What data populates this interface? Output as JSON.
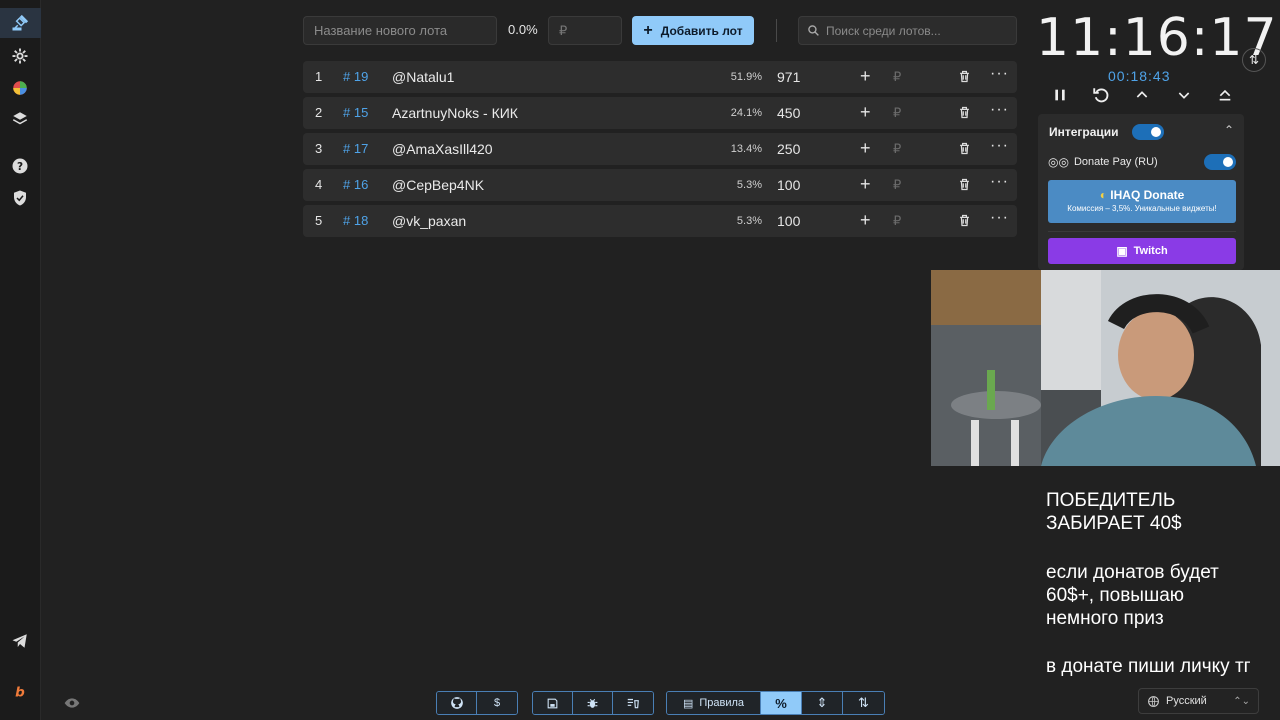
{
  "toolbar": {
    "lot_name_placeholder": "Название нового лота",
    "percent": "0.0%",
    "amount_placeholder": "₽",
    "add_label": "Добавить лот",
    "search_placeholder": "Поиск среди лотов..."
  },
  "lots": [
    {
      "index": "1",
      "id": "# 19",
      "name": "@Natalu1",
      "percent": "51.9%",
      "amount": "971",
      "currency": "₽"
    },
    {
      "index": "2",
      "id": "# 15",
      "name": "AzartnuyNoks - КИК",
      "percent": "24.1%",
      "amount": "450",
      "currency": "₽"
    },
    {
      "index": "3",
      "id": "# 17",
      "name": "@AmaXasIll420",
      "percent": "13.4%",
      "amount": "250",
      "currency": "₽"
    },
    {
      "index": "4",
      "id": "# 16",
      "name": "@CepBep4NK",
      "percent": "5.3%",
      "amount": "100",
      "currency": "₽"
    },
    {
      "index": "5",
      "id": "# 18",
      "name": "@vk_paxan",
      "percent": "5.3%",
      "amount": "100",
      "currency": "₽"
    }
  ],
  "timer": {
    "main": "11:16:17",
    "sub": "00:18:43"
  },
  "integrations": {
    "title": "Интеграции",
    "donate_pay": "Donate Pay (RU)",
    "ihaq_title": "IHAQ Donate",
    "ihaq_sub": "Комиссия – 3,5%. Уникальные виджеты!",
    "twitch": "Twitch"
  },
  "overlay": {
    "line1": "ПОБЕДИТЕЛЬ",
    "line2": "ЗАБИРАЕТ 40$",
    "line3": "если донатов будет",
    "line4": "60$+, повышаю",
    "line5": "немного приз",
    "line6": "в донате пиши личку тг"
  },
  "language": "Русский",
  "bottom": {
    "rules_label": "Правила"
  },
  "colors": {
    "accent": "#90caf9",
    "lot_id": "#4fa3e8",
    "twitch": "#8a3be6",
    "ihaq": "#4b8bc4"
  }
}
